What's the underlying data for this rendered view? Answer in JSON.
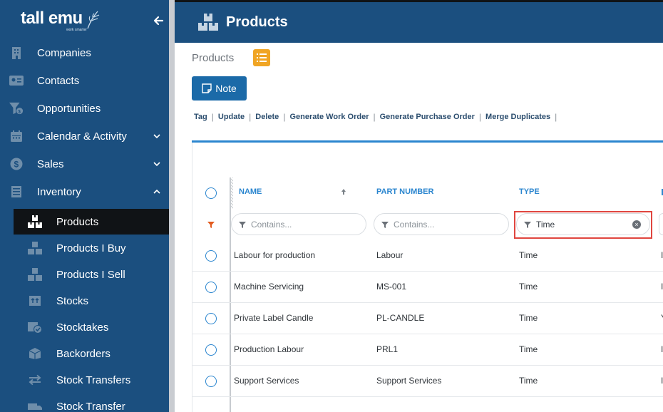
{
  "brand": {
    "name": "tall emu",
    "tagline": "work smarter"
  },
  "sidebar": {
    "items": [
      {
        "label": "Companies",
        "icon": "building-icon"
      },
      {
        "label": "Contacts",
        "icon": "contact-card-icon"
      },
      {
        "label": "Opportunities",
        "icon": "funnel-dollar-icon"
      },
      {
        "label": "Calendar & Activity",
        "icon": "calendar-icon"
      },
      {
        "label": "Sales",
        "icon": "dollar-circle-icon"
      },
      {
        "label": "Inventory",
        "icon": "inventory-icon"
      }
    ],
    "inventory_sub": [
      {
        "label": "Products",
        "icon": "boxes-icon",
        "active": true
      },
      {
        "label": "Products I Buy",
        "icon": "boxes-icon"
      },
      {
        "label": "Products I Sell",
        "icon": "boxes-icon"
      },
      {
        "label": "Stocks",
        "icon": "stock-icon"
      },
      {
        "label": "Stocktakes",
        "icon": "stocktake-icon"
      },
      {
        "label": "Backorders",
        "icon": "backorder-icon"
      },
      {
        "label": "Stock Transfers",
        "icon": "transfer-arrows-icon"
      },
      {
        "label": "Stock Transfer",
        "icon": "truck-icon"
      }
    ]
  },
  "header": {
    "title": "Products"
  },
  "breadcrumb": "Products",
  "toolbar": {
    "note_label": "Note",
    "actions": [
      "Tag",
      "Update",
      "Delete",
      "Generate Work Order",
      "Generate Purchase Order",
      "Merge Duplicates"
    ]
  },
  "grid": {
    "columns": [
      "NAME",
      "PART NUMBER",
      "TYPE"
    ],
    "filters": {
      "name_placeholder": "Contains...",
      "part_placeholder": "Contains...",
      "type_value": "Time"
    },
    "rows": [
      {
        "name": "Labour for production",
        "part": "Labour",
        "type": "Time",
        "edge": "I"
      },
      {
        "name": "Machine Servicing",
        "part": "MS-001",
        "type": "Time",
        "edge": "I"
      },
      {
        "name": "Private Label Candle",
        "part": "PL-CANDLE",
        "type": "Time",
        "edge": "Y"
      },
      {
        "name": "Production Labour",
        "part": "PRL1",
        "type": "Time",
        "edge": "I"
      },
      {
        "name": "Support Services",
        "part": "Support Services",
        "type": "Time",
        "edge": "I"
      }
    ]
  },
  "colors": {
    "sidebar_bg": "#1b4f7f",
    "accent_blue": "#2b86cf",
    "button_blue": "#1b6aa8",
    "list_button": "#f0a524",
    "highlight": "#e0463f"
  }
}
